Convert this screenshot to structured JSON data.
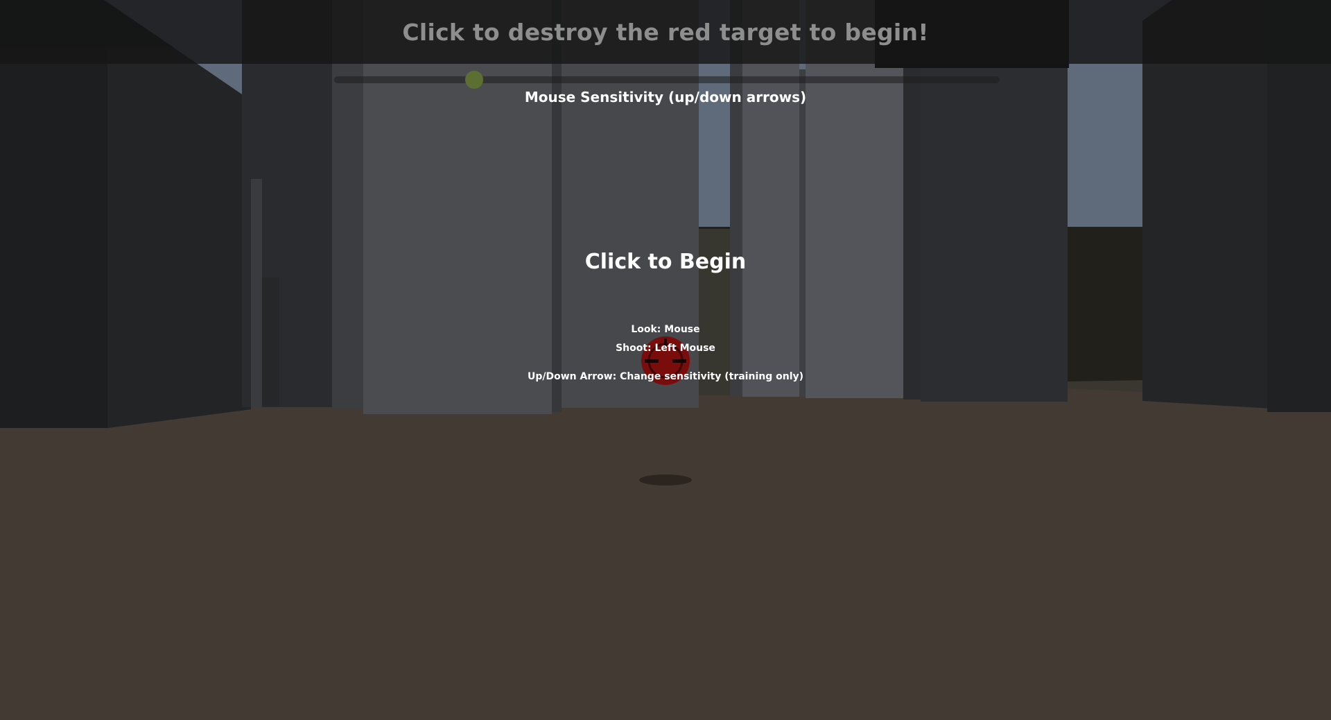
{
  "banner": {
    "text": "Click to destroy the red target to begin!"
  },
  "sensitivity": {
    "label": "Mouse Sensitivity (up/down arrows)",
    "value_fraction": 0.21
  },
  "overlay": {
    "title": "Click to Begin",
    "controls": {
      "look": "Look: Mouse",
      "shoot": "Shoot: Left Mouse",
      "arrows": "Up/Down Arrow: Change sensitivity (training only)"
    }
  },
  "colors": {
    "sky": "#5f6b7b",
    "ground": "#433a33",
    "target": "#7a0c0c",
    "slider_thumb": "#5d6e32"
  },
  "icons": {
    "target": "red-target-icon"
  }
}
